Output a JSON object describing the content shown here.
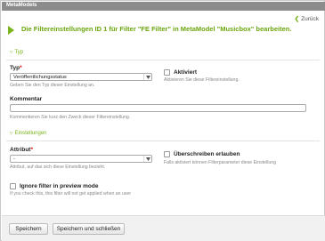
{
  "window": {
    "title": "MetaModels"
  },
  "back_link": {
    "label": "Zurück",
    "icon": "back-arrow-icon"
  },
  "page": {
    "heading": "Die Filtereinstellungen ID 1 für Filter \"FE Filter\" in MetaModel \"Musicbox\" bearbeiten."
  },
  "sections": {
    "type": {
      "legend": "Typ"
    },
    "settings": {
      "legend": "Einstellungen"
    }
  },
  "fields": {
    "typ": {
      "label": "Typ",
      "required_mark": "*",
      "value": "Veröffentlichungsstatus",
      "help": "Geben Sie den Typ dieser Einstellung an."
    },
    "aktiviert": {
      "label": "Aktiviert",
      "checked": false,
      "help": "Aktivieren Sie diese Filtereinstellung."
    },
    "kommentar": {
      "label": "Kommentar",
      "value": "",
      "help": "Kommentieren Sie kurz den Zweck dieser Filtereinstellung."
    },
    "attribut": {
      "label": "Attribut",
      "required_mark": "*",
      "value": "-",
      "help": "Attribut, auf das sich diese Einstellung bezieht."
    },
    "ueberschreiben": {
      "label": "Überschreiben erlauben",
      "checked": false,
      "help": "Falls aktiviert können Filterparameter diese Einstellung"
    },
    "ignore_preview": {
      "label": "Ignore filter in preview mode",
      "checked": false,
      "help": "If you check this, this filter will not get applied when an user"
    }
  },
  "buttons": {
    "save": "Speichern",
    "save_close": "Speichern und schließen"
  },
  "colors": {
    "accent": "#7ab51d",
    "titlebar": "#8c8c8c",
    "required": "#dd0000"
  }
}
